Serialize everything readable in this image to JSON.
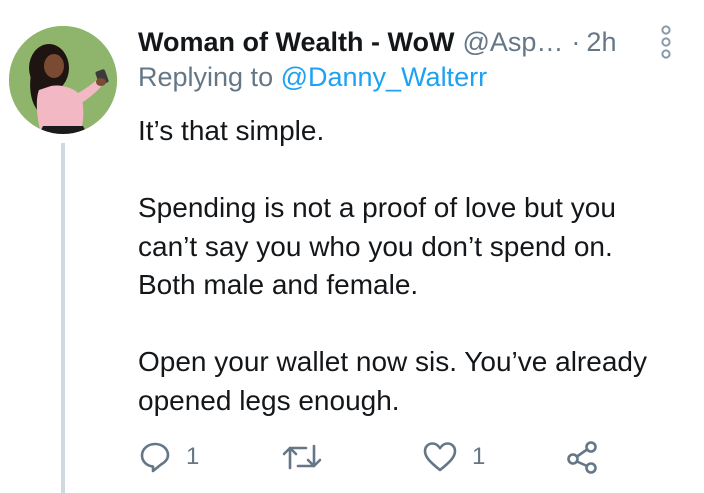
{
  "tweet": {
    "display_name": "Woman of Wealth - WoW",
    "handle": "@Asp…",
    "separator": "·",
    "time": "2h",
    "reply_prefix": "Replying to ",
    "reply_target": "@Danny_Walterr",
    "body_lines": [
      "It’s that simple.",
      "",
      "Spending is not a proof of love but you",
      "can’t say you who you don’t spend on.",
      "Both male and female.",
      "",
      "Open your wallet now sis. You’ve already",
      "opened legs enough."
    ]
  },
  "actions": {
    "reply_count": "1",
    "like_count": "1"
  },
  "icons": {
    "reply": "reply-icon",
    "retweet": "retweet-icon",
    "like": "heart-icon",
    "share": "share-icon",
    "more": "more-vertical-icon"
  },
  "colors": {
    "text": "#14171a",
    "secondary": "#657786",
    "link": "#1da1f2",
    "thread_line": "#cfd9de"
  }
}
